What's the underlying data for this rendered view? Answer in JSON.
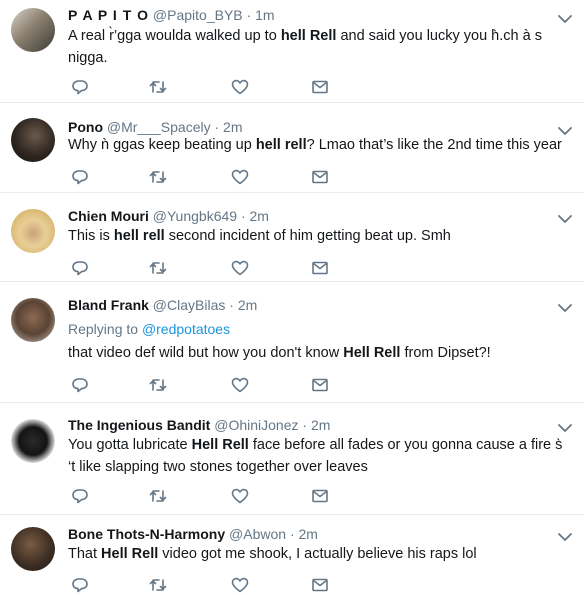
{
  "tweets": [
    {
      "name": "P A P I T O",
      "handle": "@Papito_BYB",
      "time": "1m",
      "line1": [
        {
          "t": "A real r ",
          "b": false
        },
        {
          "t": "",
          "b": false
        }
      ],
      "segments": [
        {
          "t": "A real r̀’gga woulda walked up to ",
          "b": false
        },
        {
          "t": "hell Rell",
          "b": true
        },
        {
          "t": " and said you lucky you h̀.ch à s nigga.",
          "b": false
        }
      ]
    },
    {
      "name": "Pono",
      "handle": "@Mr___Spacely",
      "time": "2m",
      "segments": [
        {
          "t": "Why ǹ ggas keep beating up ",
          "b": false
        },
        {
          "t": "hell rell",
          "b": true
        },
        {
          "t": "? Lmao that’s like the 2nd time this year",
          "b": false
        }
      ]
    },
    {
      "name": "Chien Mouri",
      "handle": "@Yungbk649",
      "time": "2m",
      "segments": [
        {
          "t": "This is ",
          "b": false
        },
        {
          "t": "hell rell",
          "b": true
        },
        {
          "t": " second incident of him getting beat up. Smh",
          "b": false
        }
      ]
    },
    {
      "name": "Bland Frank",
      "handle": "@ClayBilas",
      "time": "2m",
      "reply_prefix": "Replying to ",
      "reply_to": "@redpotatoes",
      "segments": [
        {
          "t": "that video def wild but how you don't know ",
          "b": false
        },
        {
          "t": "Hell Rell",
          "b": true
        },
        {
          "t": " from Dipset?!",
          "b": false
        }
      ]
    },
    {
      "name": "The Ingenious Bandit",
      "handle": "@OhiniJonez",
      "time": "2m",
      "segments": [
        {
          "t": "You gotta lubricate ",
          "b": false
        },
        {
          "t": "Hell Rell",
          "b": true
        },
        {
          "t": " face before all fades or you gonna cause a fire s̀ ‘t like slapping two stones together over leaves",
          "b": false
        }
      ]
    },
    {
      "name": "Bone Thots-N-Harmony",
      "handle": "@Abwon",
      "time": "2m",
      "segments": [
        {
          "t": "That ",
          "b": false
        },
        {
          "t": "Hell Rell",
          "b": true
        },
        {
          "t": " video got me shook, I actually believe his raps lol",
          "b": false
        }
      ]
    }
  ],
  "separator": "·",
  "icons": {
    "reply": "reply-icon",
    "retweet": "retweet-icon",
    "like": "like-icon",
    "dm": "message-icon",
    "menu": "chevron-down-icon"
  },
  "colors": {
    "icon": "#657786",
    "link": "#1b95e0",
    "divider": "#e6ecf0"
  }
}
